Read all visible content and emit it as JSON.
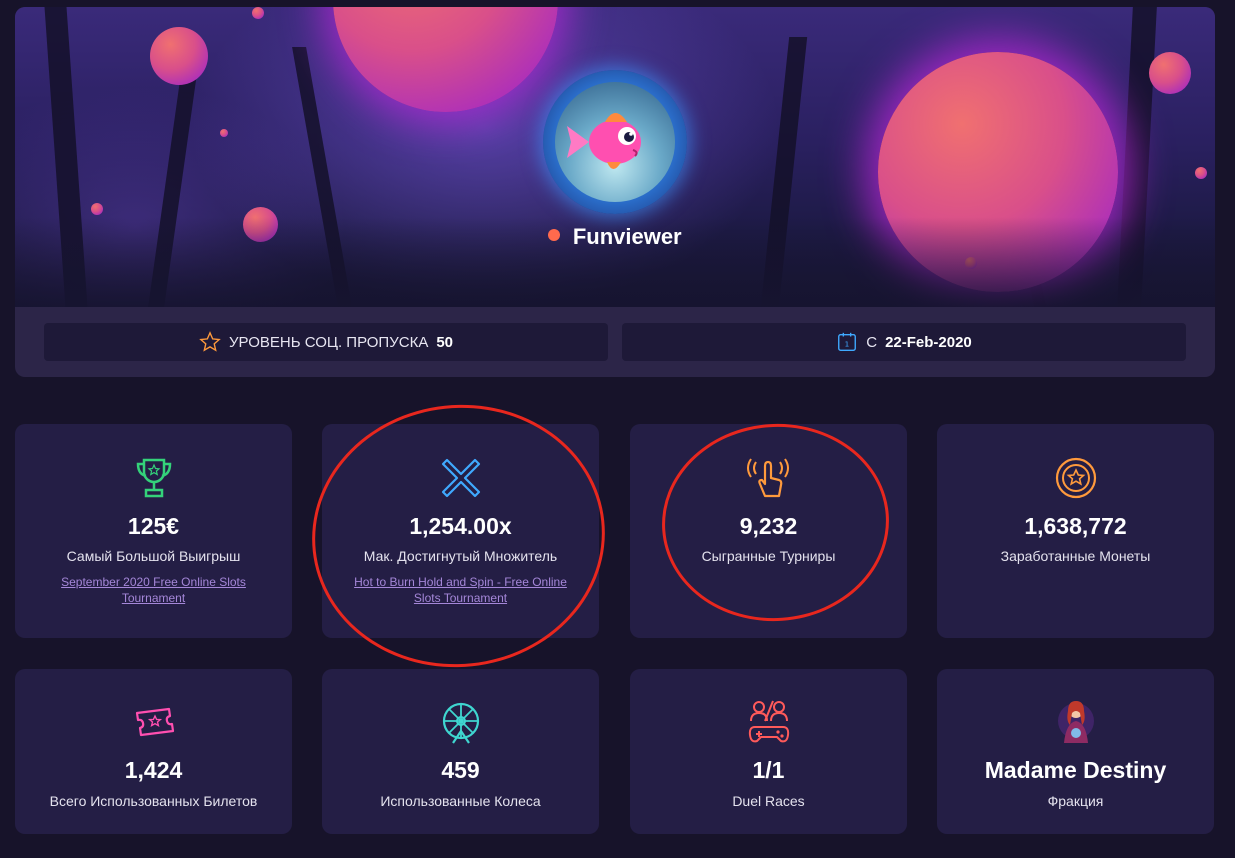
{
  "profile": {
    "username": "Funviewer",
    "status_color": "#ff6a4d",
    "avatar": "pink-fish-avatar"
  },
  "info_bar": {
    "pass_label": "УРОВЕНЬ СОЦ. ПРОПУСКА",
    "pass_level": "50",
    "since_label": "С",
    "since_date": "22-Feb-2020"
  },
  "stats": [
    {
      "icon": "trophy-icon",
      "value": "125€",
      "label": "Самый Большой Выигрыш",
      "link": "September 2020 Free Online Slots Tournament"
    },
    {
      "icon": "multiplier-x-icon",
      "value": "1,254.00x",
      "label": "Мак. Достигнутый Множитель",
      "link": "Hot to Burn Hold and Spin - Free Online Slots Tournament"
    },
    {
      "icon": "tap-hand-icon",
      "value": "9,232",
      "label": "Сыгранные Турниры"
    },
    {
      "icon": "coin-icon",
      "value": "1,638,772",
      "label": "Заработанные Монеты"
    },
    {
      "icon": "ticket-icon",
      "value": "1,424",
      "label": "Всего Использованных Билетов"
    },
    {
      "icon": "wheel-icon",
      "value": "459",
      "label": "Использованные Колеса"
    },
    {
      "icon": "gamepad-duel-icon",
      "value": "1/1",
      "label": "Duel Races"
    },
    {
      "icon": "faction-avatar-icon",
      "value": "Madame Destiny",
      "label": "Фракция"
    }
  ],
  "colors": {
    "background": "#17132a",
    "card": "#241e45",
    "link": "#a587d9",
    "annotation": "#e8271e"
  }
}
